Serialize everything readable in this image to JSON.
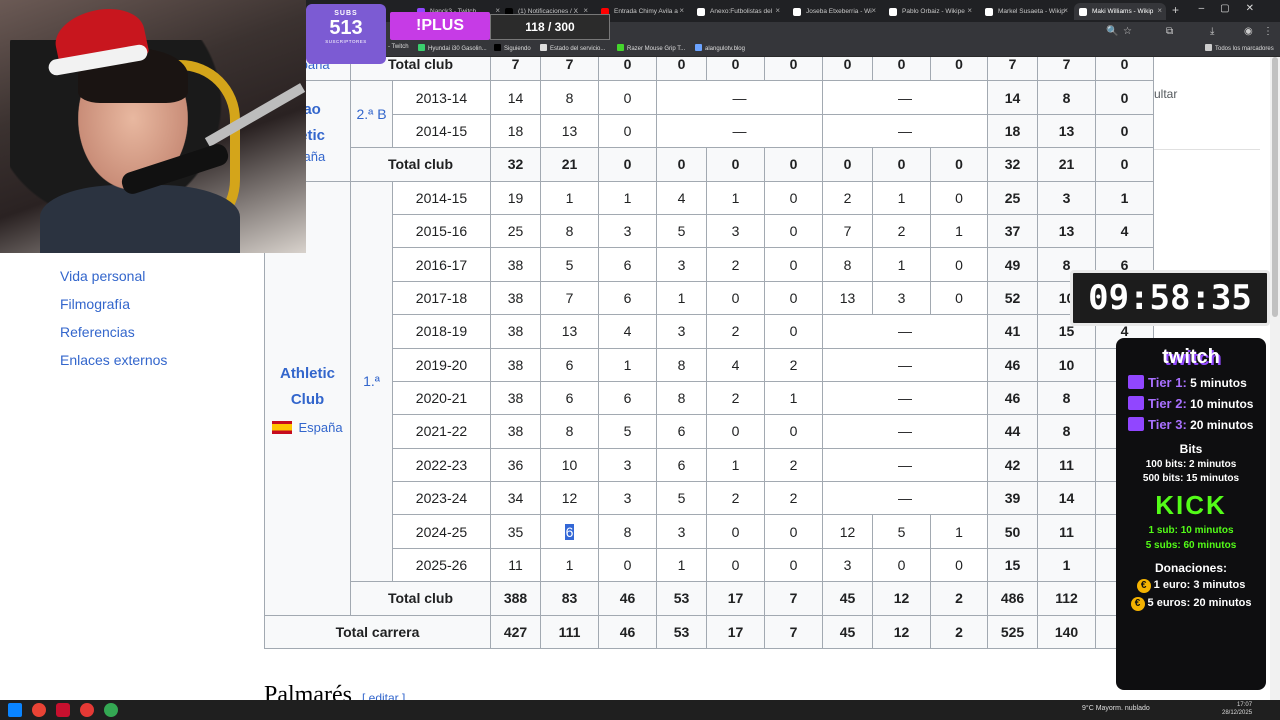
{
  "browser": {
    "tabs": [
      {
        "title": "Nanck3 - Twitch",
        "color": "#9146ff"
      },
      {
        "title": "(1) Notificaciones / X",
        "color": "#000000"
      },
      {
        "title": "Entrada Chimy Avila a",
        "color": "#ff0000"
      },
      {
        "title": "Anexo:Futbolistas del",
        "color": "#ffffff"
      },
      {
        "title": "Joseba Etxeberria - Wi",
        "color": "#ffffff"
      },
      {
        "title": "Pablo Orbaiz - Wikipe",
        "color": "#ffffff"
      },
      {
        "title": "Markel Susaeta - Wikip",
        "color": "#ffffff"
      },
      {
        "title": "Maki Williams - Wikip",
        "color": "#ffffff"
      }
    ],
    "bookmarks": [
      "- Twitch",
      "Hyundai i30 Gasolin...",
      "Siguiendo",
      "Estado del servicio...",
      "Razer Mouse Grip T...",
      "alangulotv.blog",
      "Todos los marcadores"
    ]
  },
  "toc": [
    "Vida personal",
    "Filmografía",
    "Referencias",
    "Enlaces externos"
  ],
  "hide_label": "cultar",
  "stats_table": {
    "bilbao": {
      "name_lines": [
        "bao",
        "tletic"
      ],
      "country": "spaña",
      "division": "2.ª B",
      "rows": [
        {
          "season": "2013-14",
          "c": [
            "14",
            "8",
            "0"
          ],
          "copa": "—",
          "intl": "—",
          "t": [
            "14",
            "8",
            "0"
          ]
        },
        {
          "season": "2014-15",
          "c": [
            "18",
            "13",
            "0"
          ],
          "copa": "—",
          "intl": "—",
          "t": [
            "18",
            "13",
            "0"
          ]
        }
      ],
      "total": [
        "32",
        "21",
        "0",
        "0",
        "0",
        "0",
        "0",
        "0",
        "0",
        "32",
        "21",
        "0"
      ]
    },
    "prev_total": {
      "label": "Total club",
      "country": "España",
      "values": [
        "7",
        "7",
        "0",
        "0",
        "0",
        "0",
        "0",
        "0",
        "0",
        "7",
        "7",
        "0"
      ]
    },
    "athletic": {
      "name": "Athletic Club",
      "country": "España",
      "division": "1.ª",
      "rows": [
        {
          "season": "2014-15",
          "v": [
            "19",
            "1",
            "1",
            "4",
            "1",
            "0",
            "2",
            "1",
            "0",
            "25",
            "3",
            "1"
          ]
        },
        {
          "season": "2015-16",
          "v": [
            "25",
            "8",
            "3",
            "5",
            "3",
            "0",
            "7",
            "2",
            "1",
            "37",
            "13",
            "4"
          ]
        },
        {
          "season": "2016-17",
          "v": [
            "38",
            "5",
            "6",
            "3",
            "2",
            "0",
            "8",
            "1",
            "0",
            "49",
            "8",
            "6"
          ]
        },
        {
          "season": "2017-18",
          "v": [
            "38",
            "7",
            "6",
            "1",
            "0",
            "0",
            "13",
            "3",
            "0",
            "52",
            "10",
            ""
          ]
        },
        {
          "season": "2018-19",
          "v": [
            "38",
            "13",
            "4",
            "3",
            "2",
            "0"
          ],
          "dash": "—",
          "t": [
            "41",
            "15",
            "4"
          ]
        },
        {
          "season": "2019-20",
          "v": [
            "38",
            "6",
            "1",
            "8",
            "4",
            "2"
          ],
          "dash": "—",
          "t": [
            "46",
            "10",
            ""
          ]
        },
        {
          "season": "2020-21",
          "v": [
            "38",
            "6",
            "6",
            "8",
            "2",
            "1"
          ],
          "dash": "—",
          "t": [
            "46",
            "8",
            ""
          ]
        },
        {
          "season": "2021-22",
          "v": [
            "38",
            "8",
            "5",
            "6",
            "0",
            "0"
          ],
          "dash": "—",
          "t": [
            "44",
            "8",
            ""
          ]
        },
        {
          "season": "2022-23",
          "v": [
            "36",
            "10",
            "3",
            "6",
            "1",
            "2"
          ],
          "dash": "—",
          "t": [
            "42",
            "11",
            ""
          ]
        },
        {
          "season": "2023-24",
          "v": [
            "34",
            "12",
            "3",
            "5",
            "2",
            "2"
          ],
          "dash": "—",
          "t": [
            "39",
            "14",
            ""
          ]
        },
        {
          "season": "2024-25",
          "v": [
            "35",
            "6",
            "8",
            "3",
            "0",
            "0",
            "12",
            "5",
            "1",
            "50",
            "11",
            ""
          ]
        },
        {
          "season": "2025-26",
          "v": [
            "11",
            "1",
            "0",
            "1",
            "0",
            "0",
            "3",
            "0",
            "0",
            "15",
            "1",
            ""
          ]
        }
      ],
      "total_label": "Total club",
      "total": [
        "388",
        "83",
        "46",
        "53",
        "17",
        "7",
        "45",
        "12",
        "2",
        "486",
        "112",
        ""
      ]
    },
    "career": {
      "label": "Total carrera",
      "values": [
        "427",
        "111",
        "46",
        "53",
        "17",
        "7",
        "45",
        "12",
        "2",
        "525",
        "140",
        ""
      ]
    }
  },
  "section_heading": "Palmarés",
  "edit_label": "[ editar ]",
  "overlay": {
    "subs_label": "SUBS",
    "subs_count": "513",
    "subs_sub": "SUSCRIPTORES",
    "plus_label": "!PLUS",
    "progress": "118 / 300",
    "timer": "09:58:35",
    "twitch_label": "twitch",
    "tiers": [
      {
        "name": "Tier 1:",
        "time": "5 minutos"
      },
      {
        "name": "Tier 2:",
        "time": "10 minutos"
      },
      {
        "name": "Tier 3:",
        "time": "20 minutos"
      }
    ],
    "bits_title": "Bits",
    "bits": [
      "100 bits: 2 minutos",
      "500 bits: 15 minutos"
    ],
    "kick_label": "KICK",
    "kick": [
      "1 sub: 10 minutos",
      "5 subs: 60 minutos"
    ],
    "donations_title": "Donaciones:",
    "donations": [
      "1 euro: 3 minutos",
      "5 euros: 20 minutos"
    ]
  },
  "taskbar": {
    "weather": "9°C  Mayorm. nublado",
    "time": "17:07",
    "date": "28/12/2025"
  }
}
